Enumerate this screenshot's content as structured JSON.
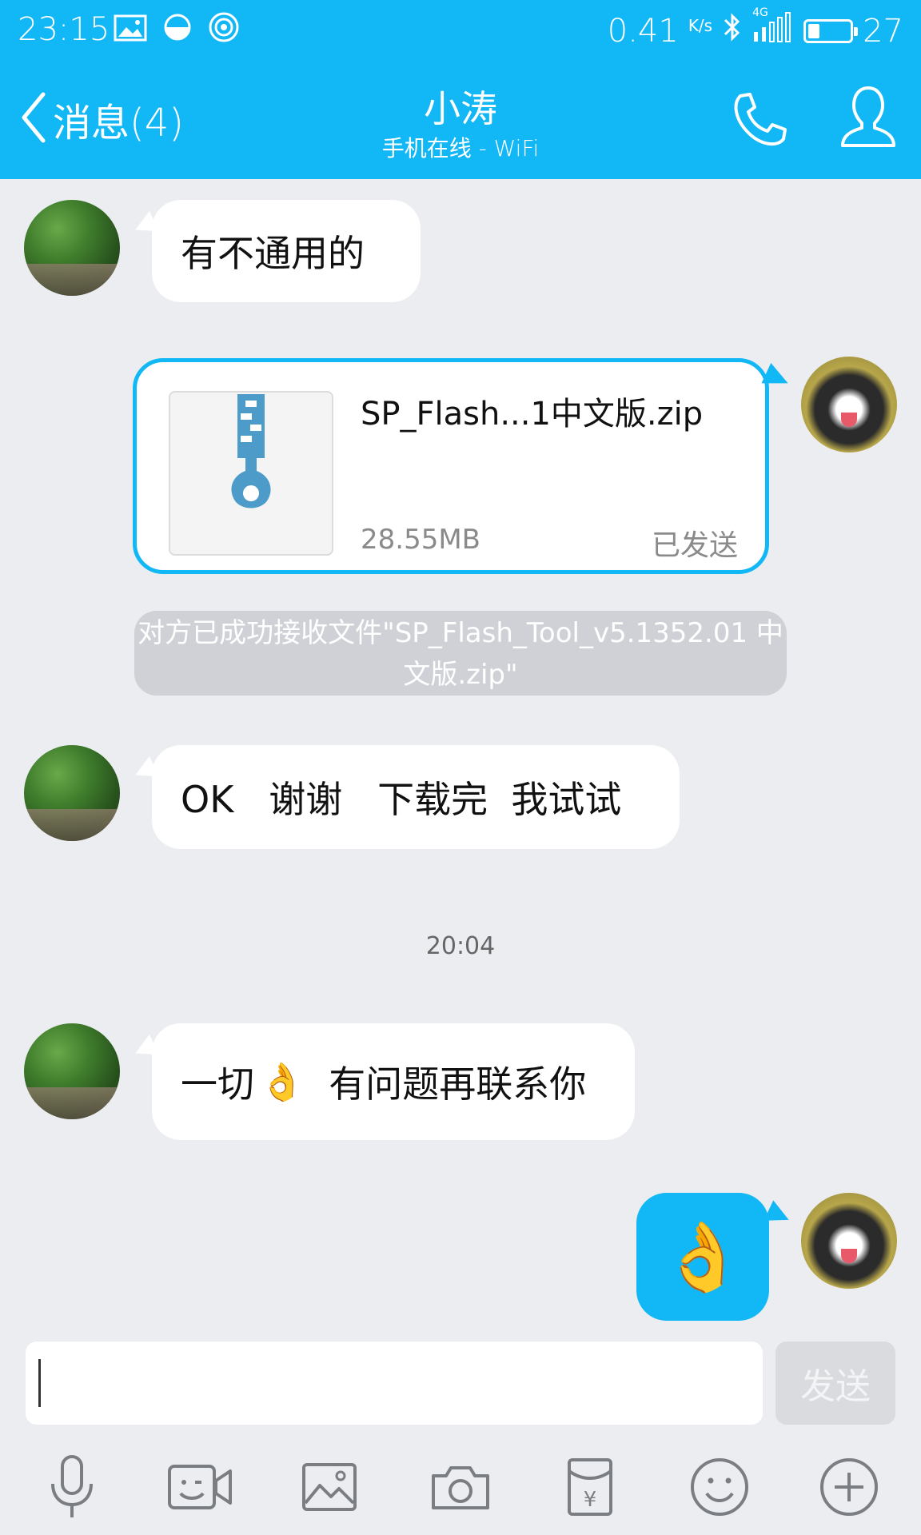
{
  "status_bar": {
    "time": "23:15",
    "net_speed": "0.41",
    "net_unit": "K/s",
    "network_type": "4G",
    "battery_level": "27",
    "battery_fraction": 0.27
  },
  "nav": {
    "back_label": "消息(4)",
    "contact_name": "小涛",
    "contact_status": "手机在线 - WiFi"
  },
  "messages": [
    {
      "side": "left",
      "text": "有不通用的"
    },
    {
      "side": "right",
      "type": "file",
      "file_name": "SP_Flash...1中文版.zip",
      "file_size": "28.55MB",
      "status": "已发送"
    },
    {
      "type": "system",
      "text": "对方已成功接收文件\"SP_Flash_Tool_v5.1352.01 中文版.zip\""
    },
    {
      "side": "left",
      "text": "OK   谢谢   下载完  我试试"
    },
    {
      "type": "time",
      "text": "20:04"
    },
    {
      "side": "left",
      "text_before": "一切",
      "emoji": "👌",
      "text_after": "有问题再联系你"
    },
    {
      "side": "right",
      "type": "emoji",
      "emoji": "👌"
    }
  ],
  "input": {
    "value": "",
    "placeholder": "",
    "send_label": "发送"
  },
  "toolbar": [
    "mic-icon",
    "video-call-icon",
    "image-icon",
    "camera-icon",
    "red-packet-icon",
    "emoji-icon",
    "plus-icon"
  ],
  "colors": {
    "accent": "#12b7f5",
    "background": "#ebedf1",
    "bubble": "#ffffff",
    "notice": "#cfd1d6"
  }
}
